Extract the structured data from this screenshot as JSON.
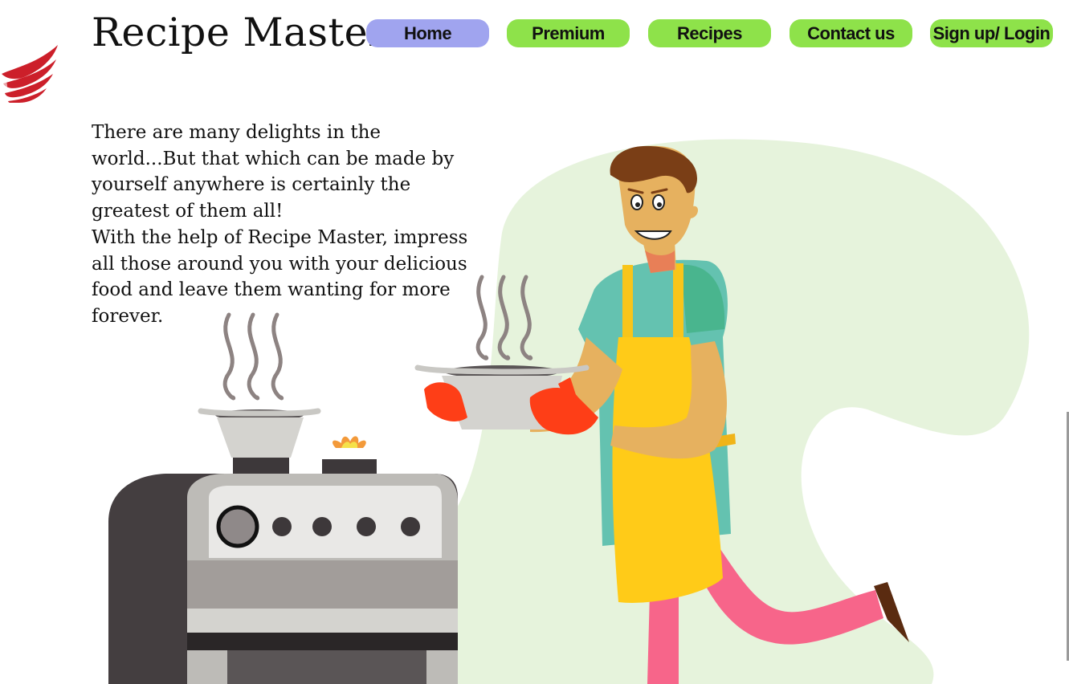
{
  "site": {
    "title": "Recipe Master"
  },
  "nav": {
    "items": [
      {
        "label": "Home"
      },
      {
        "label": "Premium"
      },
      {
        "label": "Recipes"
      },
      {
        "label": "Contact us"
      },
      {
        "label": "Sign up/ Login"
      }
    ]
  },
  "intro": {
    "paragraph1": "There  are many delights in the world...But that which can be made by yourself anywhere is certainly the greatest of them all!",
    "paragraph2": "With the help of Recipe Master, impress all those around you with your delicious food and leave them wanting for more forever."
  },
  "colors": {
    "home_button": "#a0a4ef",
    "nav_button": "#8ee24a",
    "logo": "#cc1f2a",
    "blob": "#e6f3dc"
  },
  "icons": {
    "logo": "red-wing-logo-icon"
  }
}
